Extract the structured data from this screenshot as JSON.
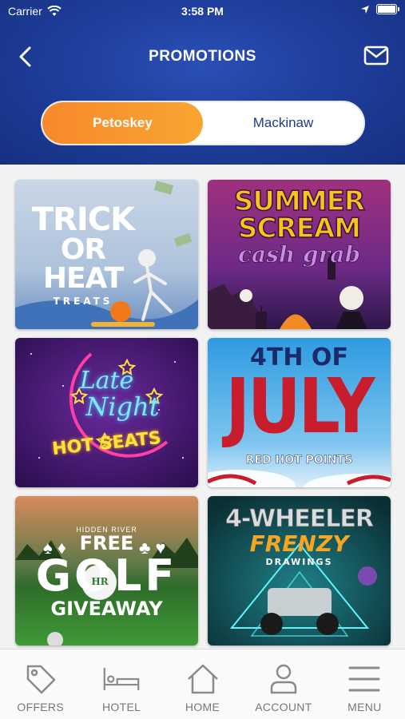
{
  "status": {
    "carrier": "Carrier",
    "time": "3:58 PM"
  },
  "header": {
    "title": "PROMOTIONS"
  },
  "locations": {
    "active": "Petoskey",
    "inactive": "Mackinaw"
  },
  "promotions": [
    {
      "line1": "TRICK",
      "line2": "OR HEAT",
      "line3": "TREATS"
    },
    {
      "line1": "SUMMER",
      "line2": "SCREAM",
      "line3": "cash grab"
    },
    {
      "line1": "Late",
      "line2": "Night",
      "line3": "HOT SEATS"
    },
    {
      "line1": "4TH OF",
      "line2": "JULY",
      "line3": "RED HOT POINTS"
    },
    {
      "line0": "HIDDEN RIVER",
      "line1": "FREE",
      "line2": "GOLF",
      "line3": "GIVEAWAY",
      "logo": "HR"
    },
    {
      "line1": "4-WHEELER",
      "line2": "FRENZY",
      "line3": "DRAWINGS"
    }
  ],
  "tabs": [
    {
      "label": "OFFERS",
      "icon": "tag-icon"
    },
    {
      "label": "HOTEL",
      "icon": "bed-icon"
    },
    {
      "label": "HOME",
      "icon": "home-icon"
    },
    {
      "label": "ACCOUNT",
      "icon": "user-icon"
    },
    {
      "label": "MENU",
      "icon": "menu-icon"
    }
  ],
  "colors": {
    "header": "#1f3f9e",
    "accent": "#f7892b",
    "tab_text": "#777777"
  }
}
